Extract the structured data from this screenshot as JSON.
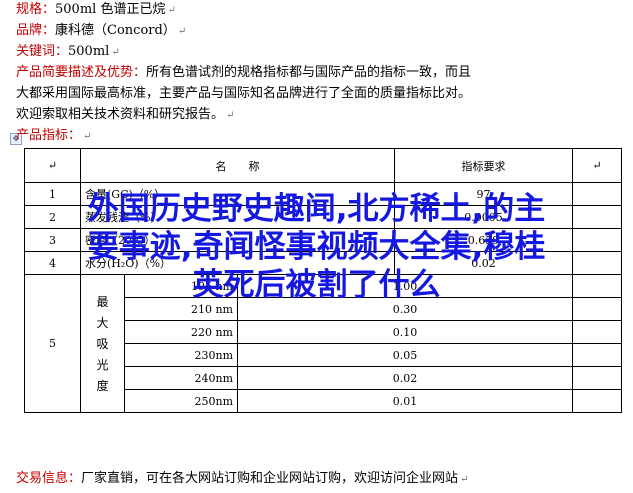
{
  "header": {
    "spec_label": "规格：",
    "spec_value": "500ml 色谱正已烷",
    "brand_label": "品牌：",
    "brand_value": "康科德（Concord）",
    "keywords_label": "关键词：",
    "keywords_value": "500ml",
    "desc_label": "产品简要描述及优势：",
    "desc_line1": "所有色谱试剂的规格指标都与国际产品的指标一致，而且",
    "desc_line2": "大都采用国际最高标准，主要产品与国际知名品牌进行了全面的质量指标比对。",
    "desc_line3": "欢迎索取相关技术资料和研究报告。",
    "indicators_label": "产品指标："
  },
  "table": {
    "header_name": "名　　称",
    "header_req": "指标要求",
    "rows": [
      {
        "no": "1",
        "name": "含量(GC)（%）",
        "req": "97"
      },
      {
        "no": "2",
        "name": "蒸发残渣（%）",
        "req": "0.0005"
      },
      {
        "no": "3",
        "name": "密度（20℃）",
        "req": "0.659"
      },
      {
        "no": "4",
        "name": "水分(H₂O)（%）",
        "req": "0.02"
      }
    ],
    "blank_mark": "↵",
    "abs_no": "5",
    "abs_label_chars": [
      "最",
      "大",
      "吸",
      "光",
      "度"
    ],
    "abs_rows": [
      {
        "wl": "195 nm",
        "val": "1.00"
      },
      {
        "wl": "210 nm",
        "val": "0.30"
      },
      {
        "wl": "220 nm",
        "val": "0.10"
      },
      {
        "wl": "230nm",
        "val": "0.05"
      },
      {
        "wl": "240nm",
        "val": "0.02"
      },
      {
        "wl": "250nm",
        "val": "0.01"
      }
    ]
  },
  "footer": {
    "trade_label": "交易信息：",
    "trade_value": "厂家直销，可在各大网站订购和企业网站订购，欢迎访问企业网站"
  },
  "overlay": {
    "line1": "外国历史野史趣闻,北方稀土,的主",
    "line2": "要事迹,奇闻怪事视频大全集,穆桂",
    "line3": "英死后被割了什么"
  },
  "colors": {
    "label_red": "#c00000",
    "overlay_blue": "#1418e0"
  }
}
